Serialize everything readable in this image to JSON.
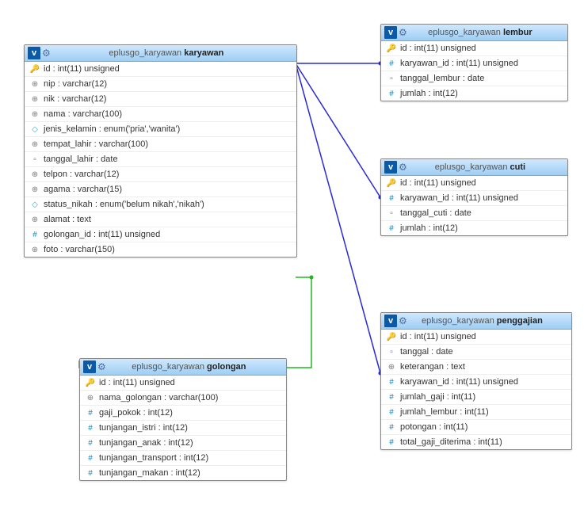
{
  "icon_map": {
    "key": {
      "glyph": "🔑",
      "cls": "ic-key"
    },
    "hash": {
      "glyph": "#",
      "cls": "ic-hash"
    },
    "text": {
      "glyph": "⊕",
      "cls": "ic-text"
    },
    "diamond": {
      "glyph": "◇",
      "cls": "ic-diamond"
    },
    "date": {
      "glyph": "▫",
      "cls": "ic-date"
    }
  },
  "tables": {
    "karyawan": {
      "schema": "eplusgo_karyawan",
      "name": "karyawan",
      "columns": [
        {
          "icon": "key",
          "label": "id : int(11) unsigned"
        },
        {
          "icon": "text",
          "label": "nip : varchar(12)"
        },
        {
          "icon": "text",
          "label": "nik : varchar(12)"
        },
        {
          "icon": "text",
          "label": "nama : varchar(100)"
        },
        {
          "icon": "diamond",
          "label": "jenis_kelamin : enum('pria','wanita')"
        },
        {
          "icon": "text",
          "label": "tempat_lahir : varchar(100)"
        },
        {
          "icon": "date",
          "label": "tanggal_lahir : date"
        },
        {
          "icon": "text",
          "label": "telpon : varchar(12)"
        },
        {
          "icon": "text",
          "label": "agama : varchar(15)"
        },
        {
          "icon": "diamond",
          "label": "status_nikah : enum('belum nikah','nikah')"
        },
        {
          "icon": "text",
          "label": "alamat : text"
        },
        {
          "icon": "hash",
          "label": "golongan_id : int(11) unsigned"
        },
        {
          "icon": "text",
          "label": "foto : varchar(150)"
        }
      ]
    },
    "lembur": {
      "schema": "eplusgo_karyawan",
      "name": "lembur",
      "columns": [
        {
          "icon": "key",
          "label": "id : int(11) unsigned"
        },
        {
          "icon": "hash",
          "label": "karyawan_id : int(11) unsigned"
        },
        {
          "icon": "date",
          "label": "tanggal_lembur : date"
        },
        {
          "icon": "hash",
          "label": "jumlah : int(12)"
        }
      ]
    },
    "cuti": {
      "schema": "eplusgo_karyawan",
      "name": "cuti",
      "columns": [
        {
          "icon": "key",
          "label": "id : int(11) unsigned"
        },
        {
          "icon": "hash",
          "label": "karyawan_id : int(11) unsigned"
        },
        {
          "icon": "date",
          "label": "tanggal_cuti : date"
        },
        {
          "icon": "hash",
          "label": "jumlah : int(12)"
        }
      ]
    },
    "penggajian": {
      "schema": "eplusgo_karyawan",
      "name": "penggajian",
      "columns": [
        {
          "icon": "key",
          "label": "id : int(11) unsigned"
        },
        {
          "icon": "date",
          "label": "tanggal : date"
        },
        {
          "icon": "text",
          "label": "keterangan : text"
        },
        {
          "icon": "hash",
          "label": "karyawan_id : int(11) unsigned"
        },
        {
          "icon": "hash",
          "label": "jumlah_gaji : int(11)"
        },
        {
          "icon": "hash",
          "label": "jumlah_lembur : int(11)"
        },
        {
          "icon": "hash",
          "label": "potongan : int(11)"
        },
        {
          "icon": "hash",
          "label": "total_gaji_diterima : int(11)"
        }
      ]
    },
    "golongan": {
      "schema": "eplusgo_karyawan",
      "name": "golongan",
      "columns": [
        {
          "icon": "key",
          "label": "id : int(11) unsigned"
        },
        {
          "icon": "text",
          "label": "nama_golongan : varchar(100)"
        },
        {
          "icon": "hash",
          "label": "gaji_pokok : int(12)"
        },
        {
          "icon": "hash",
          "label": "tunjangan_istri : int(12)"
        },
        {
          "icon": "hash",
          "label": "tunjangan_anak : int(12)"
        },
        {
          "icon": "hash",
          "label": "tunjangan_transport : int(12)"
        },
        {
          "icon": "hash",
          "label": "tunjangan_makan : int(12)"
        }
      ]
    }
  }
}
